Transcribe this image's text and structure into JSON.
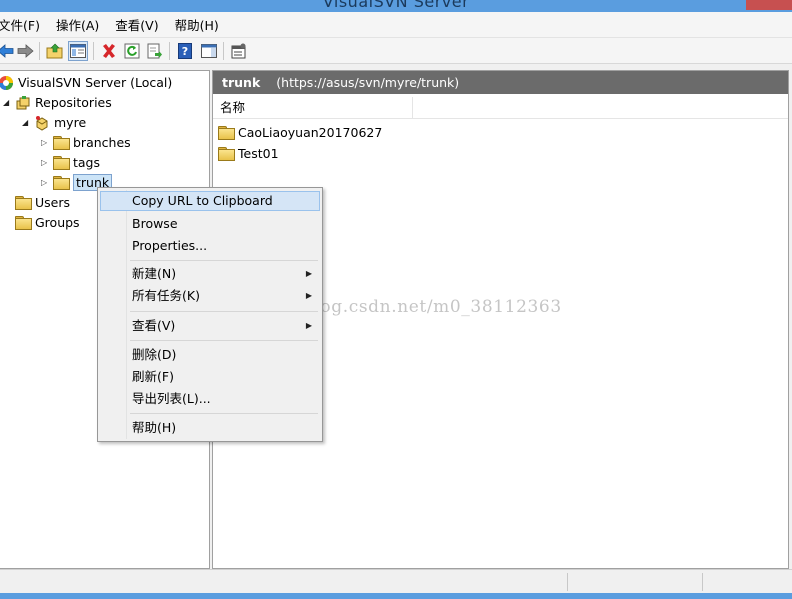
{
  "window": {
    "title": "VisualSVN Server"
  },
  "menu": [
    "文件(F)",
    "操作(A)",
    "查看(V)",
    "帮助(H)"
  ],
  "toolbar": {
    "buttons": [
      "back-icon",
      "forward-icon",
      "up-folder-icon",
      "show-hide-tree-icon",
      "delete-icon",
      "refresh-icon",
      "export-list-icon",
      "help-icon",
      "action-pane-icon",
      "properties-icon"
    ]
  },
  "tree": {
    "root": "VisualSVN Server (Local)",
    "repositories": "Repositories",
    "repo": "myre",
    "branches": "branches",
    "tags": "tags",
    "trunk": "trunk",
    "users": "Users",
    "groups": "Groups"
  },
  "right": {
    "header_name": "trunk",
    "header_url": "(https://asus/svn/myre/trunk)",
    "column_name": "名称",
    "items": [
      "CaoLiaoyuan20170627",
      "Test01"
    ]
  },
  "context_menu": {
    "copy_url": "Copy URL to Clipboard",
    "browse": "Browse",
    "properties": "Properties...",
    "new": "新建(N)",
    "all_tasks": "所有任务(K)",
    "view": "查看(V)",
    "delete": "删除(D)",
    "refresh": "刷新(F)",
    "export": "导出列表(L)...",
    "help": "帮助(H)"
  },
  "watermark": "http://blog.csdn.net/m0_38112363",
  "colors": {
    "title_bar": "#5a9ddf",
    "header_strip": "#6b6b6b",
    "menu_highlight": "#d5e5f6",
    "selection": "#cce4f7"
  }
}
